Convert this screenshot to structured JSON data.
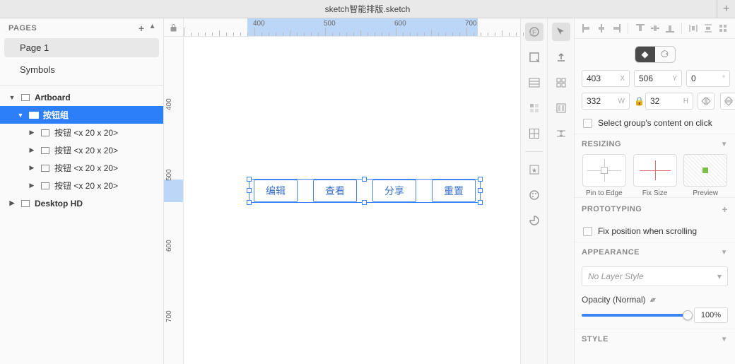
{
  "window": {
    "title": "sketch智能排版.sketch"
  },
  "pages": {
    "header": "PAGES",
    "items": [
      {
        "label": "Page 1",
        "selected": true
      },
      {
        "label": "Symbols",
        "selected": false
      }
    ]
  },
  "layers": [
    {
      "label": "Artboard",
      "indent": 0,
      "bold": true,
      "icon": "artboard",
      "expanded": true,
      "selected": false
    },
    {
      "label": "按钮组",
      "indent": 1,
      "bold": true,
      "icon": "folder",
      "expanded": true,
      "selected": true
    },
    {
      "label": "按钮 <x 20 x 20>",
      "indent": 2,
      "bold": false,
      "icon": "rect",
      "expanded": false,
      "selected": false
    },
    {
      "label": "按钮 <x 20 x 20>",
      "indent": 2,
      "bold": false,
      "icon": "rect",
      "expanded": false,
      "selected": false
    },
    {
      "label": "按钮 <x 20 x 20>",
      "indent": 2,
      "bold": false,
      "icon": "rect",
      "expanded": false,
      "selected": false
    },
    {
      "label": "按钮 <x 20 x 20>",
      "indent": 2,
      "bold": false,
      "icon": "rect",
      "expanded": false,
      "selected": false
    },
    {
      "label": "Desktop HD",
      "indent": 0,
      "bold": true,
      "icon": "artboard",
      "expanded": false,
      "selected": false
    }
  ],
  "ruler": {
    "h": [
      "400",
      "500",
      "600",
      "700"
    ],
    "v": [
      "400",
      "500",
      "600",
      "700"
    ]
  },
  "canvas": {
    "buttons": [
      "编辑",
      "查看",
      "分享",
      "重置"
    ]
  },
  "inspector": {
    "x": "403",
    "y": "506",
    "rot": "0",
    "w": "332",
    "h": "32",
    "selectGroupContent": "Select group's content on click",
    "resizing": {
      "header": "RESIZING",
      "pin": "Pin to Edge",
      "fix": "Fix Size",
      "preview": "Preview"
    },
    "prototyping": {
      "header": "PROTOTYPING",
      "fix": "Fix position when scrolling"
    },
    "appearance": {
      "header": "APPEARANCE",
      "style": "No Layer Style",
      "opacityLabel": "Opacity (Normal)",
      "opacityVal": "100%"
    },
    "styleHeader": "STYLE"
  }
}
